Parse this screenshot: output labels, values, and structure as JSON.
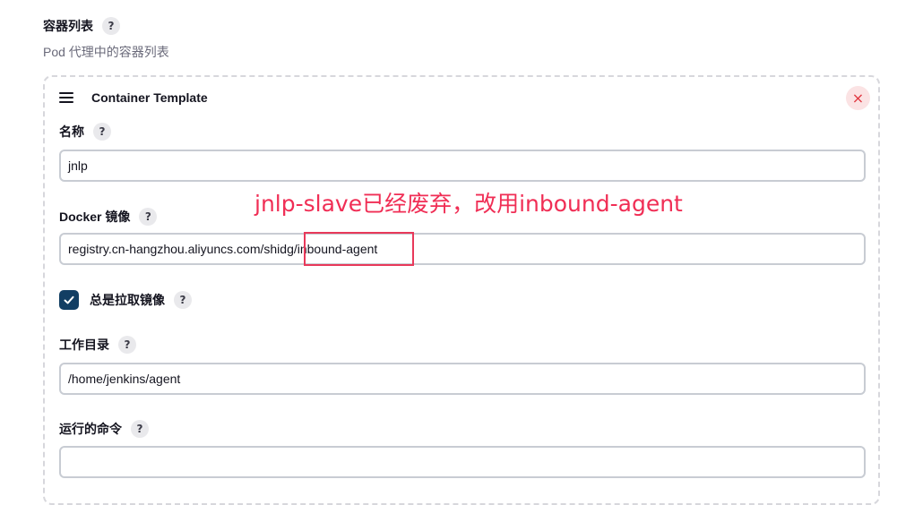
{
  "section": {
    "title": "容器列表",
    "description": "Pod 代理中的容器列表",
    "help": "?"
  },
  "card": {
    "title": "Container Template",
    "close": "×"
  },
  "fields": {
    "name": {
      "label": "名称",
      "help": "?",
      "value": "jnlp"
    },
    "image": {
      "label": "Docker 镜像",
      "help": "?",
      "value": "registry.cn-hangzhou.aliyuncs.com/shidg/inbound-agent"
    },
    "always_pull": {
      "label": "总是拉取镜像",
      "help": "?",
      "checked": true
    },
    "workdir": {
      "label": "工作目录",
      "help": "?",
      "value": "/home/jenkins/agent"
    },
    "command": {
      "label": "运行的命令",
      "help": "?",
      "value": ""
    }
  },
  "annotation": {
    "text": "jnlp-slave已经废弃，改用inbound-agent",
    "color": "#f02e55"
  },
  "colors": {
    "checkbox": "#123e63",
    "close_bg": "#fbe3e4",
    "close_fg": "#e0363f"
  }
}
